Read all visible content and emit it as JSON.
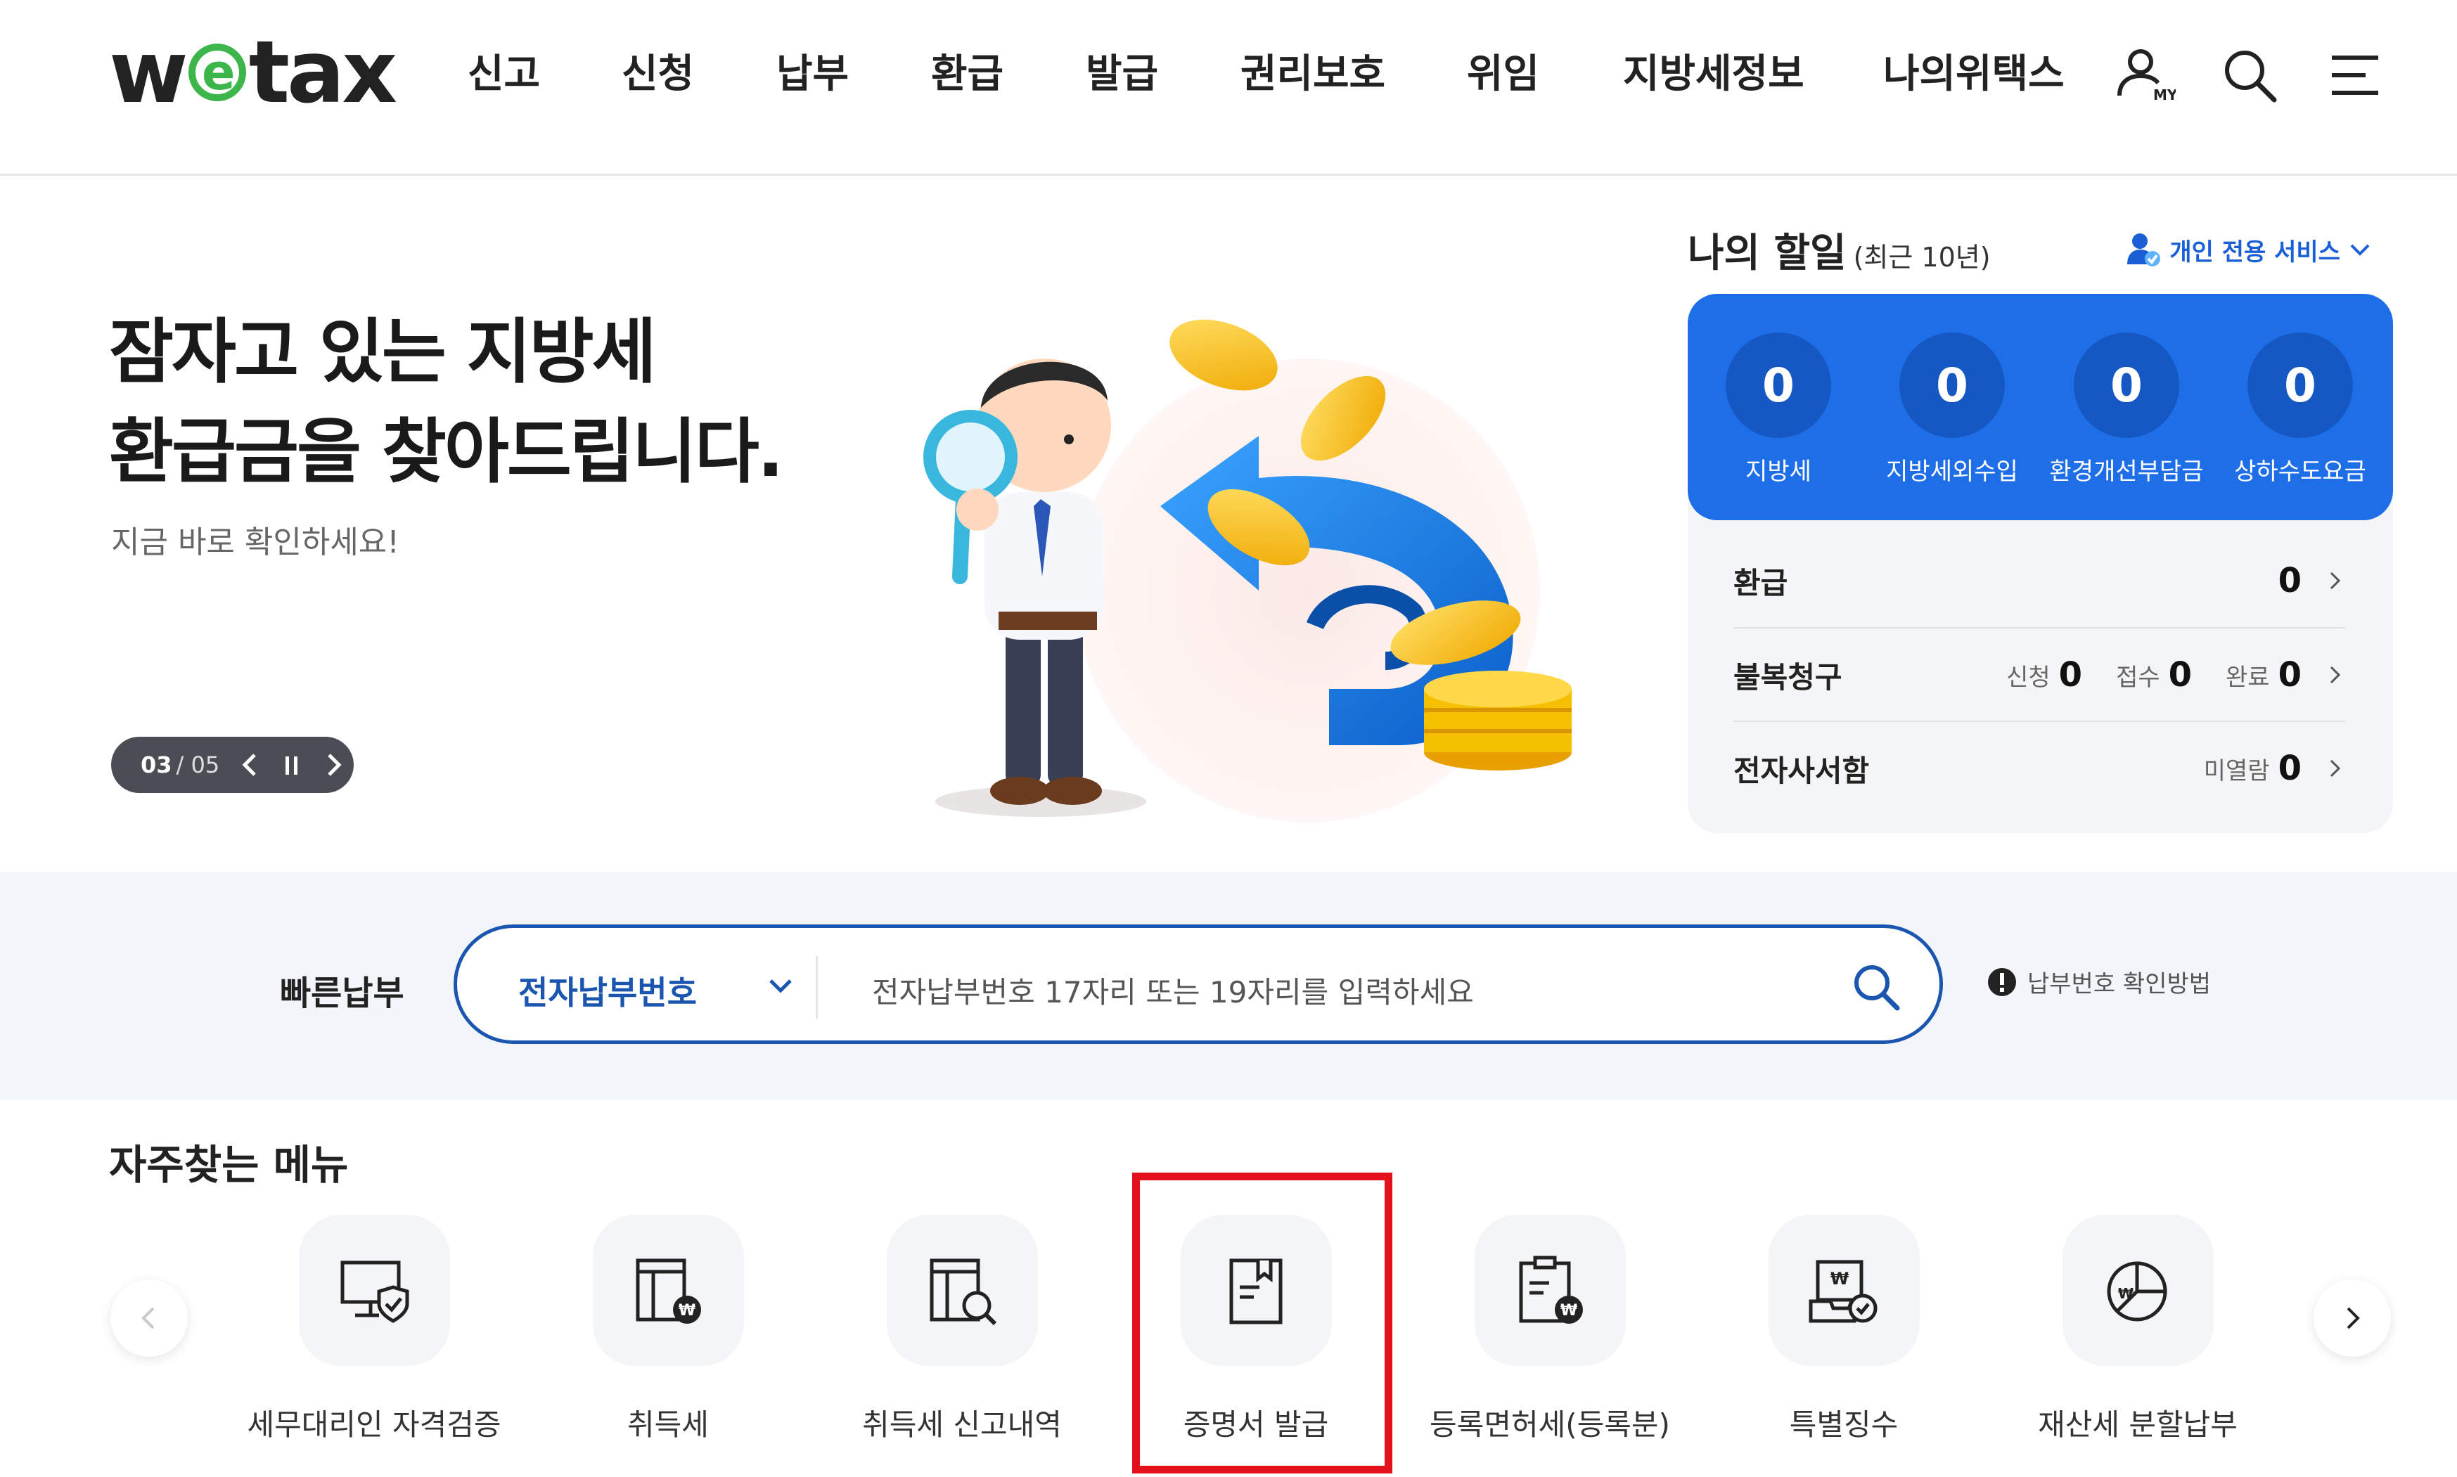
{
  "header": {
    "logo_prefix": "w",
    "logo_e": "e",
    "logo_suffix": "tax",
    "nav": [
      "신고",
      "신청",
      "납부",
      "환급",
      "발급",
      "권리보호",
      "위임",
      "지방세정보",
      "나의위택스"
    ],
    "icons": [
      "my-account-icon",
      "search-icon",
      "menu-icon"
    ],
    "my_label": "MY"
  },
  "hero": {
    "title_line1": "잠자고 있는 지방세",
    "title_line2": "환급금을 찾아드립니다.",
    "subtitle": "지금 바로 확인하세요!",
    "pager_current": "03",
    "pager_total": "/ 05"
  },
  "my_tasks": {
    "title": "나의 할일",
    "subtitle": "(최근 10년)",
    "personal_service": "개인 전용 서비스",
    "counts": [
      {
        "label": "지방세",
        "value": "0"
      },
      {
        "label": "지방세외수입",
        "value": "0"
      },
      {
        "label": "환경개선부담금",
        "value": "0"
      },
      {
        "label": "상하수도요금",
        "value": "0"
      }
    ],
    "refund_label": "환급",
    "refund_value": "0",
    "appeal_label": "불복청구",
    "appeal_apply_label": "신청",
    "appeal_apply_value": "0",
    "appeal_receipt_label": "접수",
    "appeal_receipt_value": "0",
    "appeal_done_label": "완료",
    "appeal_done_value": "0",
    "mailbox_label": "전자사서함",
    "mailbox_unread_label": "미열람",
    "mailbox_unread_value": "0"
  },
  "quick_pay": {
    "label": "빠른납부",
    "select_value": "전자납부번호",
    "placeholder": "전자납부번호 17자리 또는 19자리를 입력하세요",
    "help": "납부번호 확인방법"
  },
  "frequent_menu": {
    "title": "자주찾는 메뉴",
    "items": [
      {
        "label": "세무대리인 자격검증",
        "icon": "monitor-shield-icon"
      },
      {
        "label": "취득세",
        "icon": "building-won-icon"
      },
      {
        "label": "취득세 신고내역",
        "icon": "building-search-icon"
      },
      {
        "label": "증명서 발급",
        "icon": "certificate-icon"
      },
      {
        "label": "등록면허세(등록분)",
        "icon": "clipboard-won-icon"
      },
      {
        "label": "특별징수",
        "icon": "tray-check-icon"
      },
      {
        "label": "재산세 분할납부",
        "icon": "pie-chart-icon"
      }
    ]
  },
  "colors": {
    "accent_blue": "#1e6ee8",
    "brand_green": "#3cb64a",
    "highlight_red": "#e4101c"
  }
}
